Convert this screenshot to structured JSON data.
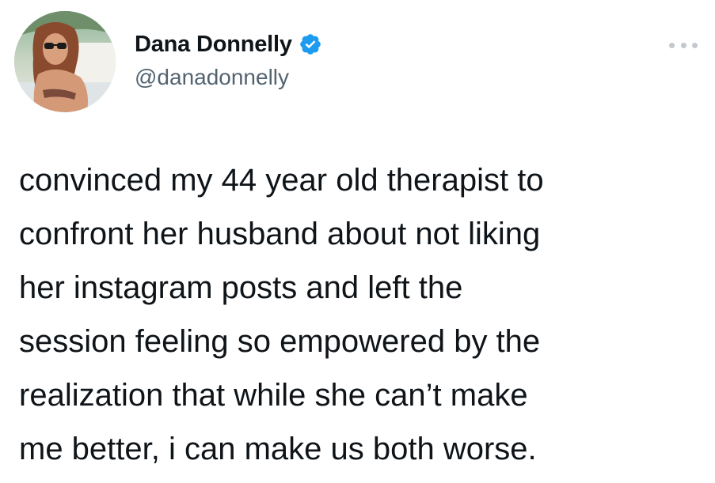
{
  "tweet": {
    "author": {
      "display_name": "Dana Donnelly",
      "handle": "@danadonnelly",
      "verified": true,
      "avatar_icon": "profile-photo",
      "verified_icon": "verified-badge-icon",
      "verified_color": "#1d9bf0"
    },
    "more_icon": "more-options-icon",
    "lines": [
      "convinced my 44 year old therapist to",
      "confront her husband about not liking",
      "her instagram posts and left the",
      "session feeling so empowered by the",
      "realization that while she can’t make",
      "me better, i can make us both worse."
    ]
  },
  "colors": {
    "text": "#0f1419",
    "secondary": "#536471",
    "background": "#ffffff",
    "more_dots": "#c2c8cc"
  }
}
